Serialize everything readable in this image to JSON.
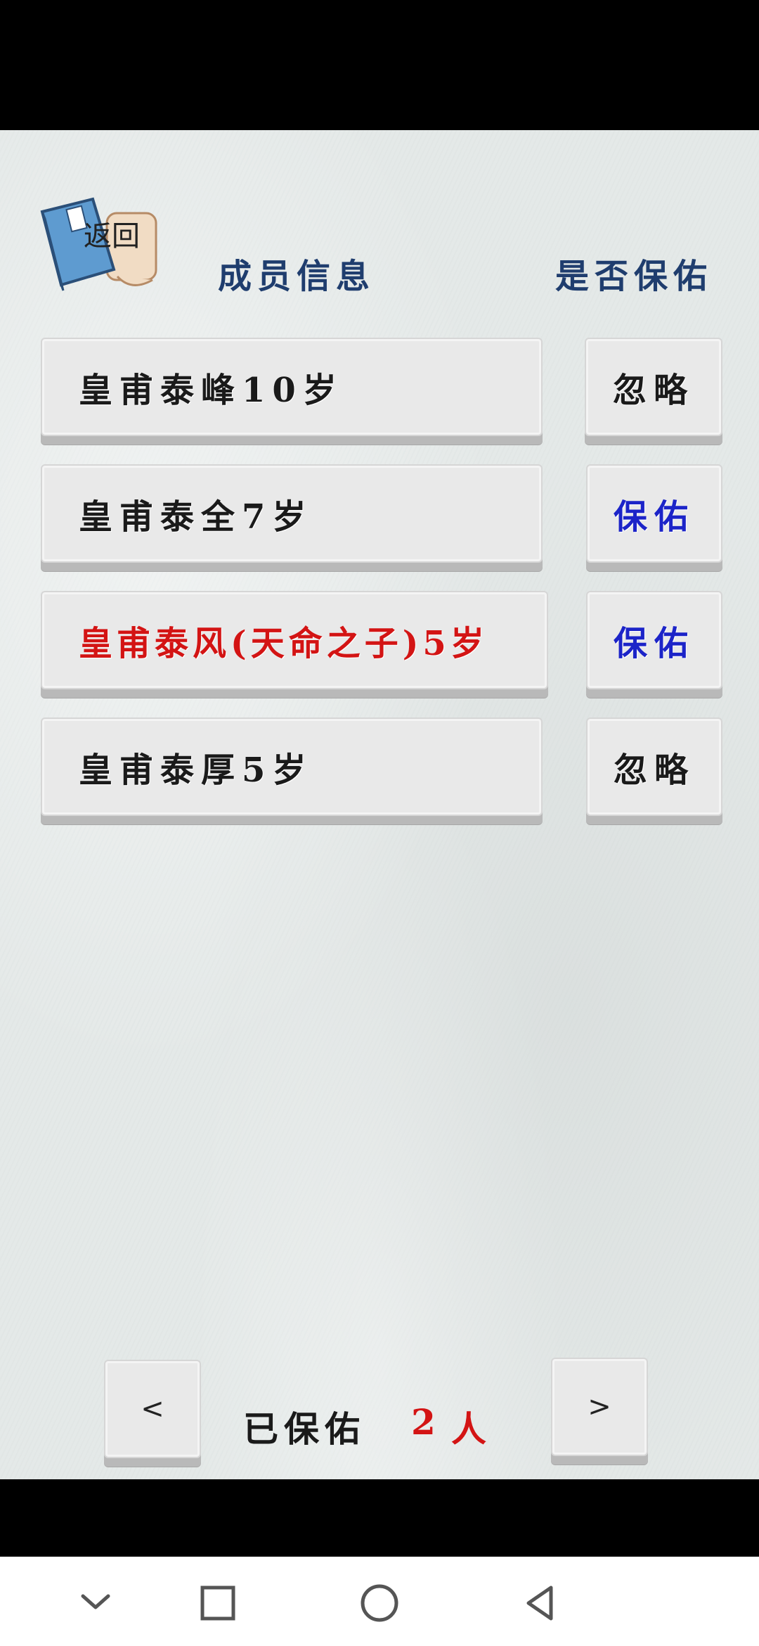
{
  "header": {
    "back_label": "返回",
    "col_member": "成员信息",
    "col_bless": "是否保佑"
  },
  "members": [
    {
      "label": "皇甫泰峰10岁",
      "highlight": false,
      "action": "忽略",
      "action_type": "ignore"
    },
    {
      "label": "皇甫泰全7岁",
      "highlight": false,
      "action": "保佑",
      "action_type": "bless"
    },
    {
      "label": "皇甫泰风(天命之子)5岁",
      "highlight": true,
      "action": "保佑",
      "action_type": "bless"
    },
    {
      "label": "皇甫泰厚5岁",
      "highlight": false,
      "action": "忽略",
      "action_type": "ignore"
    }
  ],
  "footer": {
    "prev": "<",
    "next": ">",
    "blessed_label": "已保佑",
    "blessed_count": "2",
    "unit": "人"
  },
  "colors": {
    "header_blue": "#1f3d6e",
    "bless_blue": "#1c24c8",
    "highlight_red": "#d31414",
    "paper": "#e4e9e8"
  },
  "nav": {
    "icons": [
      "chevron-down-icon",
      "square-icon",
      "circle-icon",
      "triangle-back-icon"
    ]
  }
}
